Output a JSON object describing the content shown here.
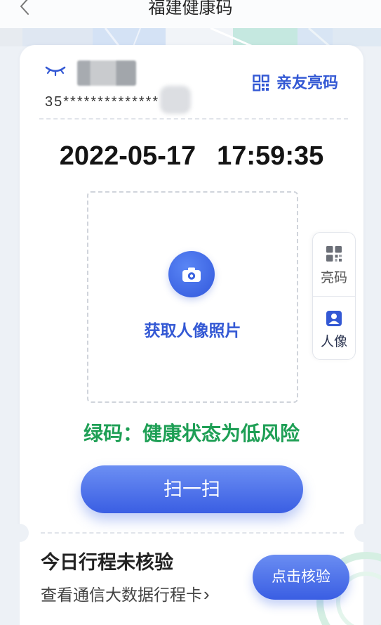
{
  "header": {
    "title": "福建健康码",
    "back_icon": "chevron-left-icon"
  },
  "user": {
    "eye_icon": "eye-closed-icon",
    "id_masked": "35**************"
  },
  "family_code": {
    "icon": "qr-grid-icon",
    "label": "亲友亮码"
  },
  "datetime": {
    "date": "2022-05-17",
    "time": "17:59:35"
  },
  "photo": {
    "icon": "camera-icon",
    "label": "获取人像照片"
  },
  "side_tabs": [
    {
      "icon": "qr-code-icon",
      "label": "亮码",
      "active": false
    },
    {
      "icon": "person-icon",
      "label": "人像",
      "active": true
    }
  ],
  "status": {
    "text": "绿码：健康状态为低风险"
  },
  "scan_button": {
    "label": "扫一扫"
  },
  "trip": {
    "title": "今日行程未核验",
    "link_text": "查看通信大数据行程卡",
    "link_arrow": "›",
    "verify_button": "点击核验"
  },
  "colors": {
    "accent": "#3358d4",
    "status_green": "#1e9f55",
    "background": "#edf1f6"
  }
}
